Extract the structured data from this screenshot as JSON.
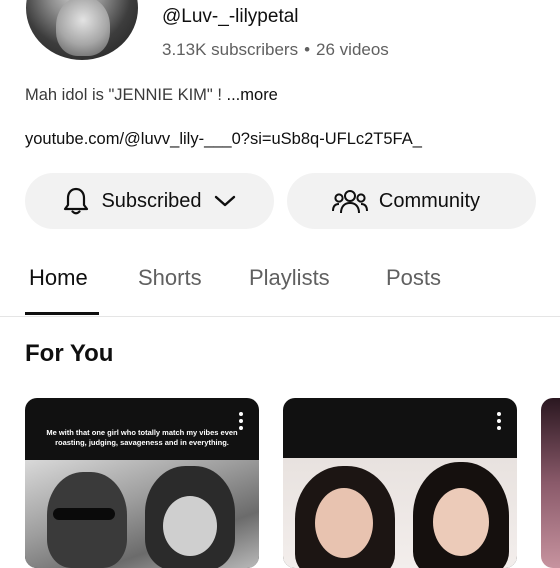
{
  "channel": {
    "handle": "@Luv-_-lilypetal",
    "subscribers": "3.13K subscribers",
    "separator": "•",
    "videos": "26 videos",
    "bio": "Mah idol is \"JENNIE KIM\" ! ",
    "bio_more": "...more",
    "link": "youtube.com/@luvv_lily-___0?si=uSb8q-UFLc2T5FA_"
  },
  "actions": {
    "subscribed_label": "Subscribed",
    "community_label": "Community"
  },
  "tabs": [
    {
      "label": "Home",
      "active": true
    },
    {
      "label": "Shorts",
      "active": false
    },
    {
      "label": "Playlists",
      "active": false
    },
    {
      "label": "Posts",
      "active": false
    }
  ],
  "section": {
    "title": "For You"
  },
  "videos": [
    {
      "caption": "Me with that one girl who totally match my vibes even roasting, judging, savageness and in everything."
    },
    {
      "caption": ""
    }
  ],
  "icons": {
    "bell": "bell-icon",
    "chevron": "chevron-down-icon",
    "community": "community-icon",
    "more": "more-vert-icon"
  },
  "colors": {
    "pill_bg": "#f2f2f2",
    "secondary_text": "#606060",
    "primary_text": "#0f0f0f"
  }
}
